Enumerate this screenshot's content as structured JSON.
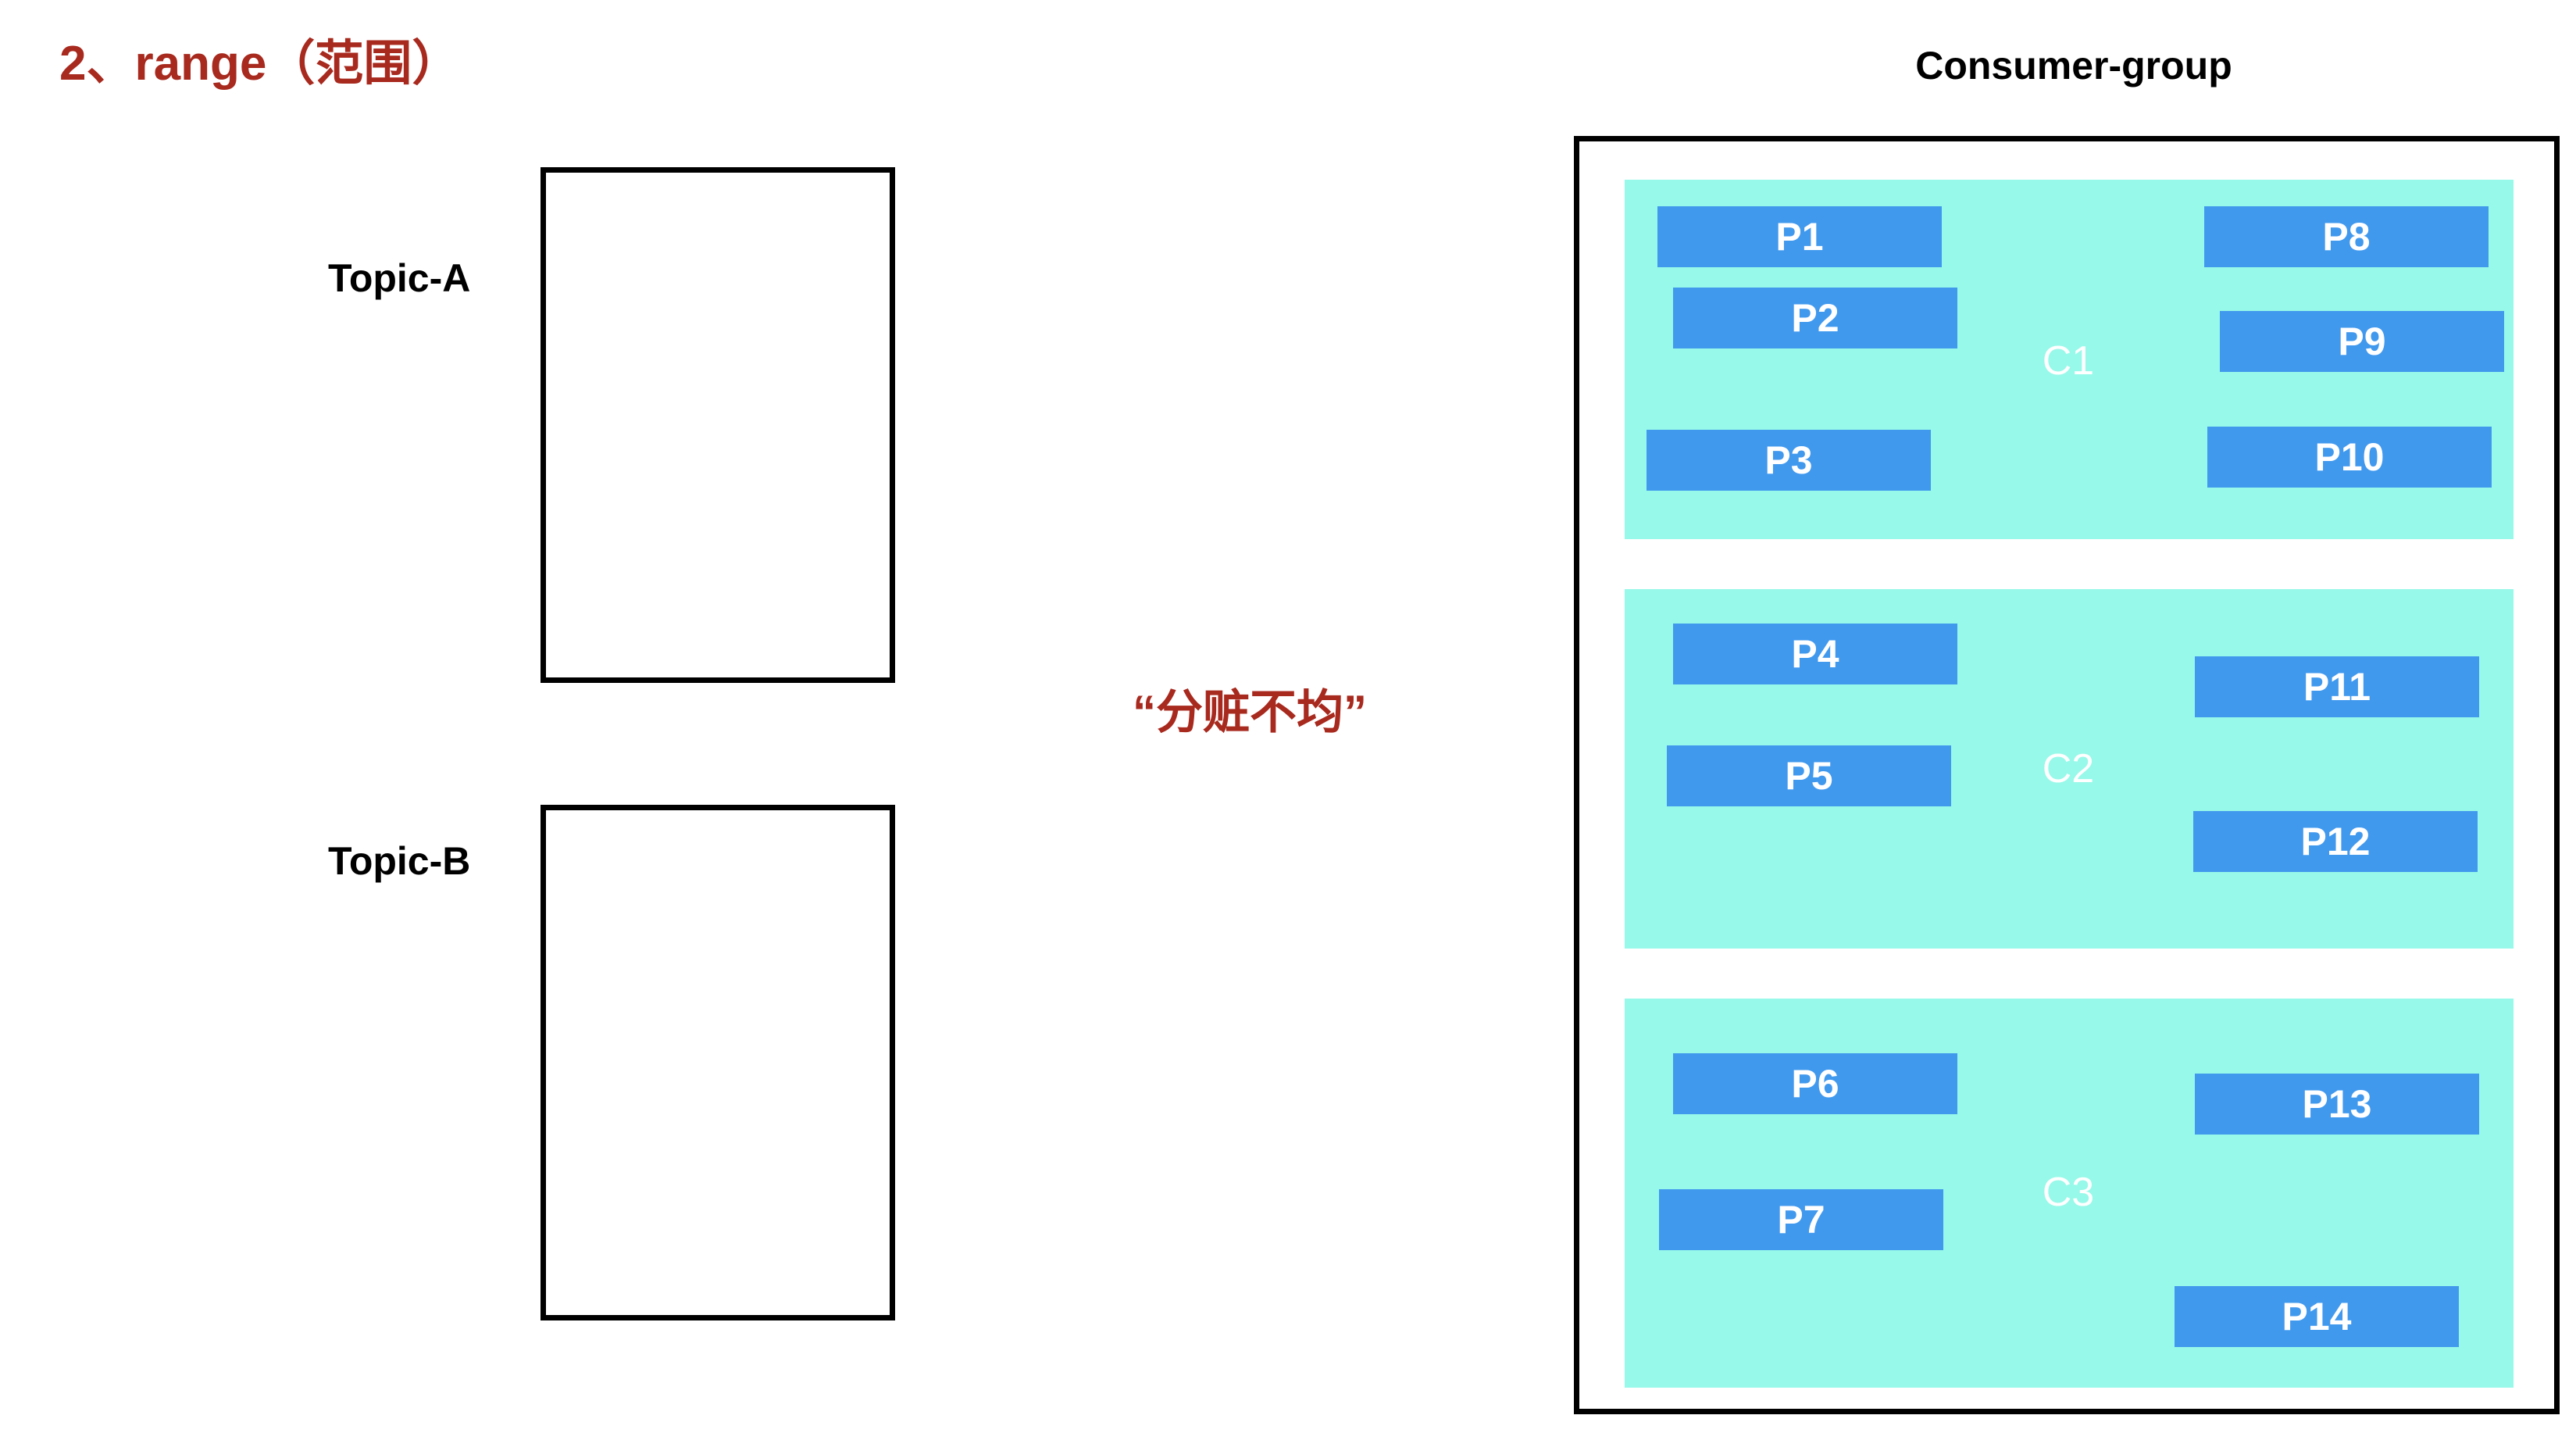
{
  "title": "2、range（范围）",
  "annotation": "“分赃不均”",
  "colors": {
    "accent": "#a8291e",
    "consumer_bg": "#97f9e9",
    "partition_bg": "#4199ee"
  },
  "topics": [
    {
      "label": "Topic-A"
    },
    {
      "label": "Topic-B"
    }
  ],
  "consumer_group": {
    "title": "Consumer-group",
    "consumers": [
      {
        "label": "C1",
        "partitions": [
          "P1",
          "P2",
          "P3",
          "P8",
          "P9",
          "P10"
        ]
      },
      {
        "label": "C2",
        "partitions": [
          "P4",
          "P5",
          "P11",
          "P12"
        ]
      },
      {
        "label": "C3",
        "partitions": [
          "P6",
          "P7",
          "P13",
          "P14"
        ]
      }
    ]
  }
}
